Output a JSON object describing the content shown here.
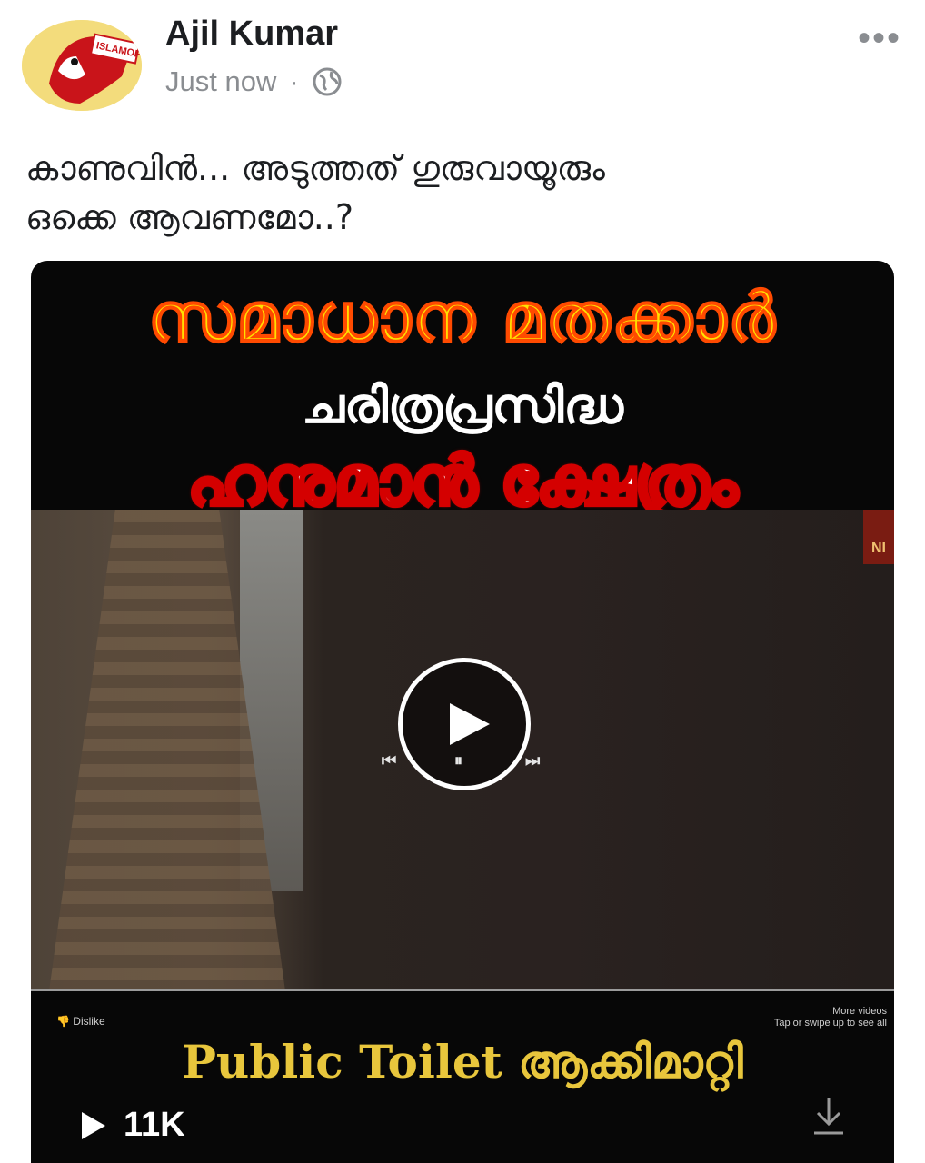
{
  "post": {
    "author": "Ajil Kumar",
    "time": "Just now",
    "separator": "·",
    "privacy_icon": "globe-icon",
    "more_icon": "more-options-icon",
    "caption_line1": "കാണുവിൻ... അടുത്തത് ഗുരുവായൂരും",
    "caption_line2": "ഒക്കെ ആവണമോ..?"
  },
  "avatar": {
    "label": "ISLAMOFO"
  },
  "video": {
    "headline1": "സമാധാന മതക്കാർ",
    "headline2": "ചരിത്രപ്രസിദ്ധ",
    "headline3": "ഹനുമാൻ ക്ഷേത്രം",
    "bottom_text": "Public Toilet ആക്കിമാറ്റി",
    "dislike_label": "Dislike",
    "more_videos_label": "More videos",
    "more_videos_hint": "Tap or swipe up to see all",
    "channel_mark": "NI",
    "views": "11K",
    "play_icon": "play-icon",
    "download_icon": "download-icon"
  }
}
